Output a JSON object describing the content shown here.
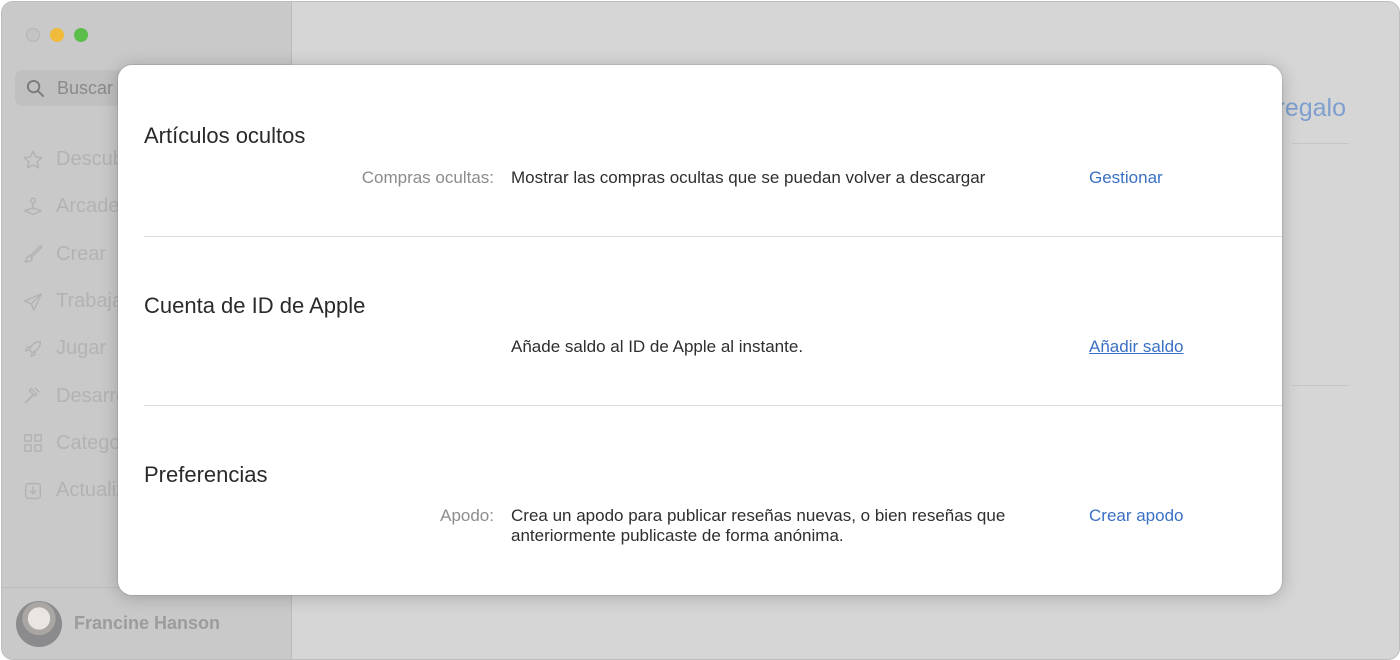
{
  "sidebar": {
    "search_placeholder": "Buscar",
    "items": [
      {
        "label": "Descubrir",
        "icon": "star-icon"
      },
      {
        "label": "Arcade",
        "icon": "joystick-icon"
      },
      {
        "label": "Crear",
        "icon": "brush-icon"
      },
      {
        "label": "Trabajar",
        "icon": "paperplane-icon"
      },
      {
        "label": "Jugar",
        "icon": "rocket-icon"
      },
      {
        "label": "Desarrollar",
        "icon": "hammer-icon"
      },
      {
        "label": "Categorías",
        "icon": "grid-icon"
      },
      {
        "label": "Actualizaciones",
        "icon": "download-icon"
      }
    ],
    "user_name": "Francine Hanson"
  },
  "background": {
    "header_link": "regalo"
  },
  "sheet": {
    "hidden": {
      "title": "Artículos ocultos",
      "label": "Compras ocultas:",
      "description": "Mostrar las compras ocultas que se puedan volver a descargar",
      "action": "Gestionar"
    },
    "account": {
      "title": "Cuenta de ID de Apple",
      "description": "Añade saldo al ID de Apple al instante.",
      "action": "Añadir saldo"
    },
    "preferences": {
      "title": "Preferencias",
      "label": "Apodo:",
      "description": "Crea un apodo para publicar reseñas nuevas, o bien reseñas que anteriormente publicaste de forma anónima.",
      "action": "Crear apodo"
    }
  },
  "colors": {
    "link": "#3a70c5",
    "dimmed_text": "#b3b3b3"
  }
}
